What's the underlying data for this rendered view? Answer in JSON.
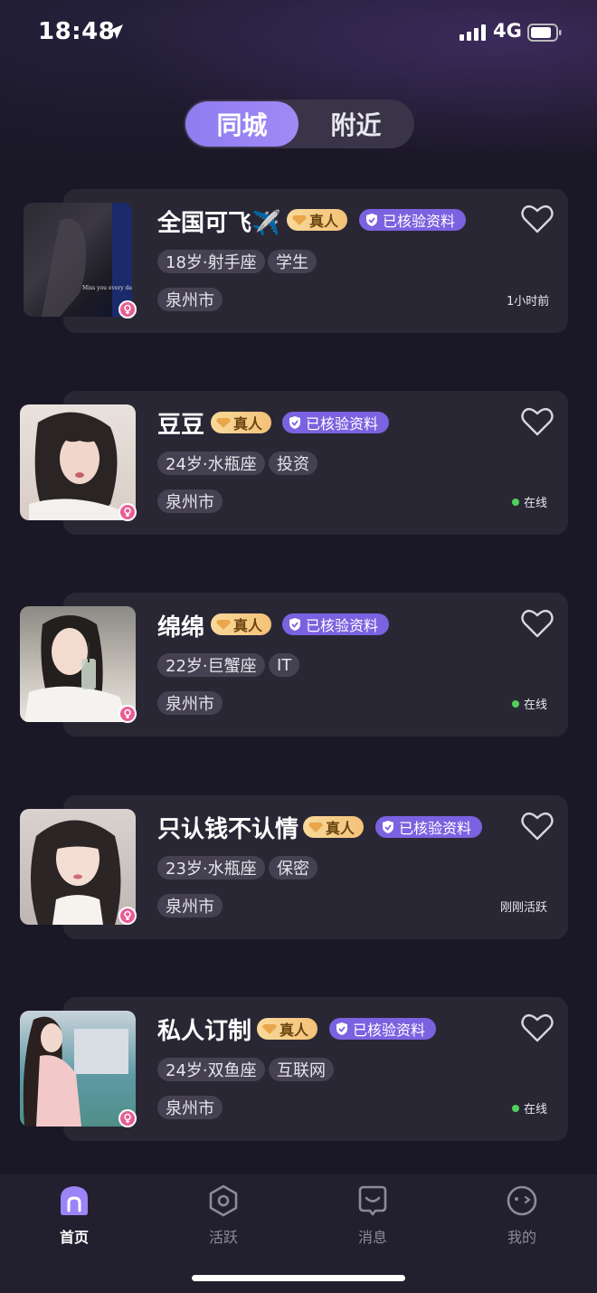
{
  "status_bar": {
    "time": "18:48",
    "network": "4G"
  },
  "segmented": {
    "active": "同城",
    "inactive": "附近"
  },
  "badges": {
    "real": "真人",
    "verified": "已核验资料"
  },
  "profiles": [
    {
      "name": "全国可飞✈️",
      "age_sign": "18岁·射手座",
      "job": "学生",
      "city": "泉州市",
      "status": "1小时前",
      "online": false
    },
    {
      "name": "豆豆",
      "age_sign": "24岁·水瓶座",
      "job": "投资",
      "city": "泉州市",
      "status": "在线",
      "online": true
    },
    {
      "name": "绵绵",
      "age_sign": "22岁·巨蟹座",
      "job": "IT",
      "city": "泉州市",
      "status": "在线",
      "online": true
    },
    {
      "name": "只认钱不认情",
      "age_sign": "23岁·水瓶座",
      "job": "保密",
      "city": "泉州市",
      "status": "刚刚活跃",
      "online": false
    },
    {
      "name": "私人订制",
      "age_sign": "24岁·双鱼座",
      "job": "互联网",
      "city": "泉州市",
      "status": "在线",
      "online": true
    }
  ],
  "tabbar": {
    "items": [
      "首页",
      "活跃",
      "消息",
      "我的"
    ],
    "active": "首页"
  },
  "colors": {
    "accent": "#8f7cf0",
    "online": "#4fd05a",
    "female": "#e85d95",
    "background": "#1a1726"
  }
}
